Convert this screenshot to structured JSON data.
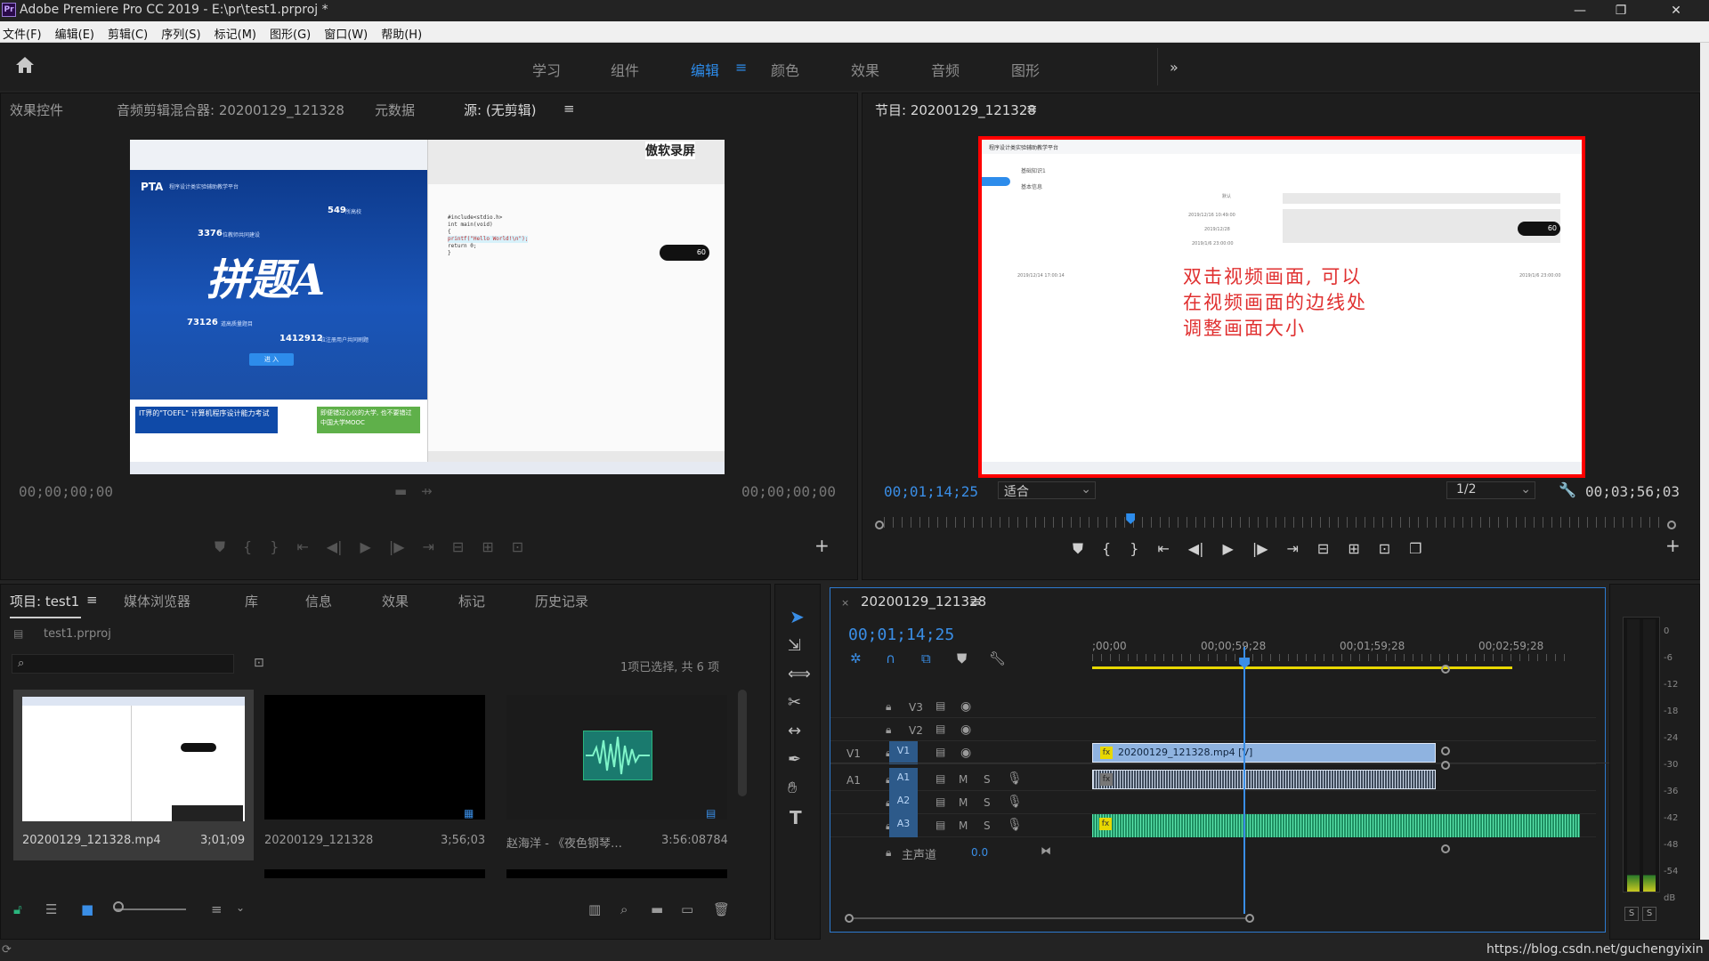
{
  "window": {
    "title": "Adobe Premiere Pro CC 2019 - E:\\pr\\test1.prproj *",
    "app_badge": "Pr",
    "minimize": "—",
    "maximize": "❐",
    "close": "✕"
  },
  "menu": [
    "文件(F)",
    "编辑(E)",
    "剪辑(C)",
    "序列(S)",
    "标记(M)",
    "图形(G)",
    "窗口(W)",
    "帮助(H)"
  ],
  "workspaces": {
    "items": [
      "学习",
      "组件",
      "编辑",
      "颜色",
      "效果",
      "音频",
      "图形"
    ],
    "active": "编辑",
    "more": "»"
  },
  "source_panel": {
    "tabs": [
      "效果控件",
      "音频剪辑混合器: 20200129_121328",
      "元数据",
      "源: (无剪辑)"
    ],
    "active_tab": "源: (无剪辑)",
    "timecode_left": "00;00;00;00",
    "timecode_right": "00;00;00;00",
    "preview": {
      "watermark": "傲软录屏",
      "pta_title": "PTA",
      "pta_subtitle": "程序设计类实验辅助教学平台",
      "stat1": "549",
      "stat1_label": "所高校",
      "stat2": "3376",
      "stat2_label": "位教师共同建设",
      "stat3": "73126",
      "stat3_label": "道高质量题目",
      "stat4": "1412912",
      "stat4_label": "位注册用户共同刷题",
      "banner_text": "拼题A",
      "enter": "进 入",
      "ad1": "IT界的\"TOEFL\" 计算机程序设计能力考试",
      "ad2": "即便错过心仪的大学, 也不要错过中国大学MOOC",
      "code_lines": [
        "#include<stdio.h>",
        "int main(void)",
        "{",
        "  printf(\"Hello World!\\n\");",
        "  return 0;",
        "}"
      ],
      "fps": "60"
    }
  },
  "program_panel": {
    "title": "节目: 20200129_121328",
    "timecode_current": "00;01;14;25",
    "timecode_total": "00;03;56;03",
    "fit": "适合",
    "resolution": "1/2",
    "annotation_lines": [
      "双击视频画面, 可以",
      "在视频画面的边线处",
      "调整画面大小"
    ],
    "playhead_fraction": 0.315,
    "preview": {
      "header": "程序设计类实验辅助教学平台",
      "section": "基础知识1",
      "label1": "基本信息",
      "row1": "默认",
      "row2": "2019/12/16 10:49:00",
      "row3": "2019/12/28",
      "row4": "2019/1/6 23:00:00",
      "date_left": "2019/12/14 17:00:14",
      "date_right": "2019/1/6 23:00:00",
      "fps": "60"
    }
  },
  "project_panel": {
    "tabs": [
      "项目: test1",
      "媒体浏览器",
      "库",
      "信息",
      "效果",
      "标记",
      "历史记录"
    ],
    "active_tab": "项目: test1",
    "file": "test1.prproj",
    "selection_info": "1项已选择, 共 6 项",
    "items": [
      {
        "name": "20200129_121328.mp4",
        "duration": "3;01;09"
      },
      {
        "name": "20200129_121328",
        "duration": "3;56;03"
      },
      {
        "name": "赵海洋 - 《夜色钢琴…",
        "duration": "3:56:08784"
      }
    ]
  },
  "timeline": {
    "sequence": "20200129_121328",
    "timecode": "00;01;14;25",
    "ruler_labels": [
      ";00;00",
      "00;00;59;28",
      "00;01;59;28",
      "00;02;59;28"
    ],
    "tracks": [
      {
        "id": "V3",
        "type": "video"
      },
      {
        "id": "V2",
        "type": "video"
      },
      {
        "id": "V1",
        "type": "video",
        "source": "V1",
        "clip": "20200129_121328.mp4 [V]"
      },
      {
        "id": "A1",
        "type": "audio",
        "source": "A1"
      },
      {
        "id": "A2",
        "type": "audio"
      },
      {
        "id": "A3",
        "type": "audio"
      }
    ],
    "master": {
      "label": "主声道",
      "value": "0.0"
    },
    "m": "M",
    "s": "S"
  },
  "meter": {
    "labels": [
      "0",
      "-6",
      "-12",
      "-18",
      "-24",
      "-30",
      "-36",
      "-42",
      "-48",
      "-54",
      "dB"
    ],
    "solo": "S"
  },
  "statusbar": {
    "url": "https://blog.csdn.net/guchengyixin"
  },
  "colors": {
    "accent": "#2d8ceb",
    "annotation": "#e03030",
    "highlight_border": "#ff0000",
    "clip_video": "#8fb3e0",
    "clip_audio": "#2ab57d"
  }
}
